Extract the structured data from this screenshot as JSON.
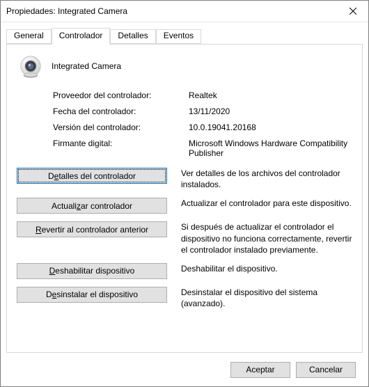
{
  "title": "Propiedades: Integrated Camera",
  "tabs": {
    "general": "General",
    "controlador": "Controlador",
    "detalles": "Detalles",
    "eventos": "Eventos"
  },
  "device_name": "Integrated Camera",
  "props": {
    "provider_label": "Proveedor del controlador:",
    "provider_value": "Realtek",
    "date_label": "Fecha del controlador:",
    "date_value": "13/11/2020",
    "version_label": "Versión del controlador:",
    "version_value": "10.0.19041.20168",
    "signer_label": "Firmante digital:",
    "signer_value": "Microsoft Windows Hardware Compatibility Publisher"
  },
  "buttons": {
    "details": {
      "pre": "D",
      "u": "e",
      "post": "talles del controlador",
      "desc": "Ver detalles de los archivos del controlador instalados."
    },
    "update": {
      "pre": "Actuali",
      "u": "z",
      "post": "ar controlador",
      "desc": "Actualizar el controlador para este dispositivo."
    },
    "rollback": {
      "pre": "",
      "u": "R",
      "post": "evertir al controlador anterior",
      "desc": "Si después de actualizar el controlador el dispositivo no funciona correctamente, revertir el controlador instalado previamente."
    },
    "disable": {
      "pre": "",
      "u": "D",
      "post": "eshabilitar dispositivo",
      "desc": "Deshabilitar el dispositivo."
    },
    "uninstall": {
      "pre": "D",
      "u": "e",
      "post": "sinstalar el dispositivo",
      "desc": "Desinstalar el dispositivo del sistema (avanzado)."
    }
  },
  "footer": {
    "ok": "Aceptar",
    "cancel": "Cancelar"
  }
}
